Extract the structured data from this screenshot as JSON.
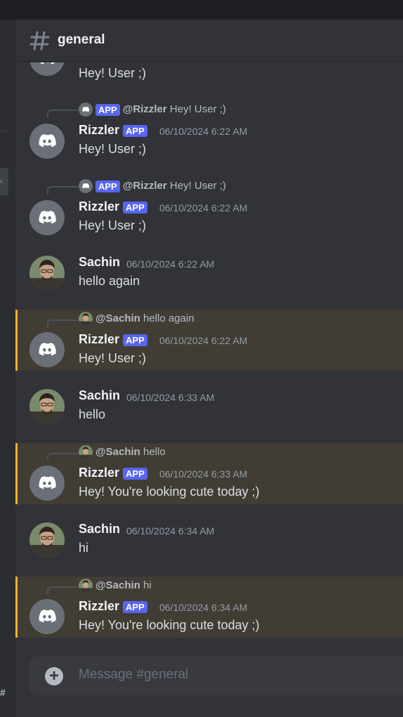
{
  "channel": {
    "name": "general"
  },
  "messages": [
    {
      "type": "cont",
      "text": "Hey! User ;)"
    },
    {
      "type": "bot",
      "reply": {
        "badge": "APP",
        "mention": "@Rizzler",
        "text": "Hey! User ;)"
      },
      "author": "Rizzler",
      "badge": "APP",
      "timestamp": "06/10/2024 6:22 AM",
      "text": "Hey! User ;)"
    },
    {
      "type": "bot",
      "reply": {
        "badge": "APP",
        "mention": "@Rizzler",
        "text": "Hey! User ;)"
      },
      "author": "Rizzler",
      "badge": "APP",
      "timestamp": "06/10/2024 6:22 AM",
      "text": "Hey! User ;)"
    },
    {
      "type": "user",
      "author": "Sachin",
      "timestamp": "06/10/2024 6:22 AM",
      "text": "hello again"
    },
    {
      "type": "bot",
      "highlight": true,
      "reply": {
        "mention": "@Sachin",
        "text": "hello again"
      },
      "author": "Rizzler",
      "badge": "APP",
      "timestamp": "06/10/2024 6:22 AM",
      "text": "Hey! User ;)"
    },
    {
      "type": "user",
      "author": "Sachin",
      "timestamp": "06/10/2024 6:33 AM",
      "text": "hello"
    },
    {
      "type": "bot",
      "highlight": true,
      "reply": {
        "mention": "@Sachin",
        "text": "hello"
      },
      "author": "Rizzler",
      "badge": "APP",
      "timestamp": "06/10/2024 6:33 AM",
      "text": "Hey! You're looking cute today ;)"
    },
    {
      "type": "user",
      "author": "Sachin",
      "timestamp": "06/10/2024 6:34 AM",
      "text": "hi"
    },
    {
      "type": "bot",
      "highlight": true,
      "reply": {
        "mention": "@Sachin",
        "text": "hi"
      },
      "author": "Rizzler",
      "badge": "APP",
      "timestamp": "06/10/2024 6:34 AM",
      "text": "Hey! You're looking cute today ;)"
    }
  ],
  "composer": {
    "placeholder": "Message #general",
    "add_icon": "plus-circle-icon"
  },
  "colors": {
    "accent": "#5865f2",
    "highlight_bar": "#f0b232",
    "highlight_bg": "#413d35",
    "background": "#313338"
  }
}
